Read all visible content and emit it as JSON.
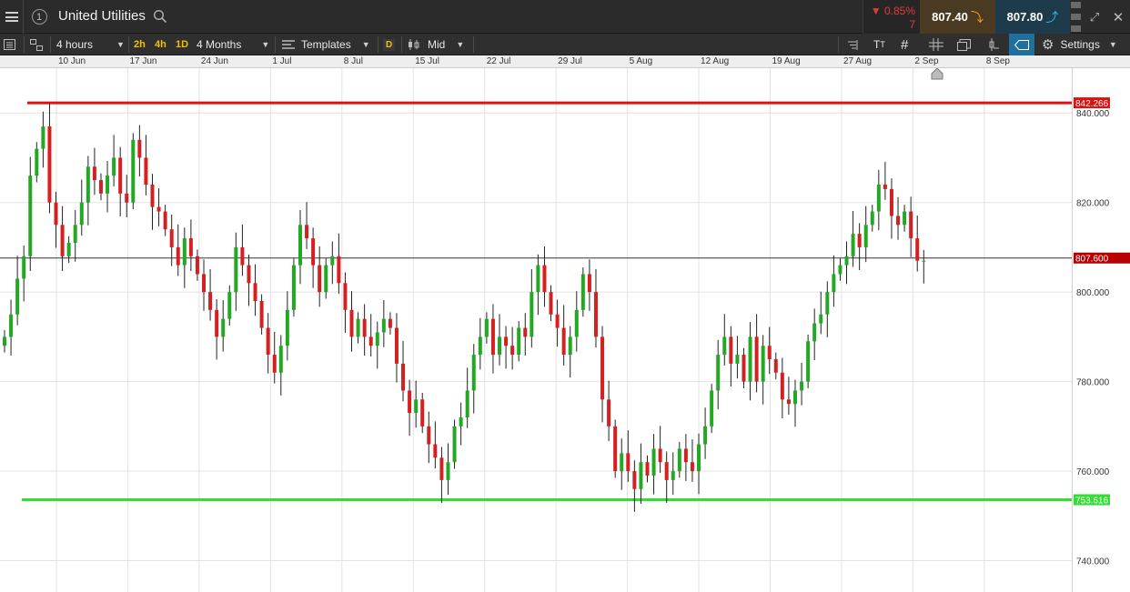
{
  "header": {
    "instrument": "United Utilities",
    "change_pct": "0.85%",
    "change_value": "7",
    "change_icon": "triangle-down-icon",
    "sell_price": "807.40",
    "buy_price": "807.80",
    "colors": {
      "down": "#e23b3b",
      "sell_bg": "#4a3a22",
      "buy_bg": "#1d3b4a"
    }
  },
  "toolbar": {
    "interval": "4 hours",
    "quick_2h": "2h",
    "quick_4h": "4h",
    "quick_1d": "1D",
    "range": "4 Months",
    "templates": "Templates",
    "d_badge": "D",
    "price_type": "Mid",
    "settings": "Settings"
  },
  "chart_data": {
    "type": "candlestick",
    "instrument": "United Utilities",
    "ylim": [
      733,
      850
    ],
    "y_ticks": [
      740,
      760,
      780,
      800,
      820,
      840
    ],
    "y_tick_labels": [
      "740.000",
      "760.000",
      "780.000",
      "800.000",
      "820.000",
      "840.000"
    ],
    "x_tick_labels": [
      "10 Jun",
      "17 Jun",
      "24 Jun",
      "1 Jul",
      "8 Jul",
      "15 Jul",
      "22 Jul",
      "29 Jul",
      "5 Aug",
      "12 Aug",
      "19 Aug",
      "27 Aug",
      "2 Sep",
      "8 Sep"
    ],
    "grid": true,
    "current_price": 807.6,
    "current_price_label": "807.600",
    "resistance": 842.266,
    "resistance_label": "842.266",
    "support": 753.616,
    "support_label": "753.616",
    "colors": {
      "up": "#22a822",
      "down": "#d42020",
      "resistance": "#e01010",
      "support": "#33dd33",
      "current": "#b80000"
    },
    "closes": [
      790,
      795,
      803,
      808,
      826,
      832,
      837,
      820,
      815,
      808,
      811,
      815,
      820,
      828,
      825,
      822,
      826,
      830,
      822,
      820,
      834,
      830,
      824,
      819,
      818,
      814,
      810,
      806,
      812,
      808,
      804,
      800,
      796,
      790,
      794,
      800,
      810,
      806,
      802,
      798,
      792,
      786,
      782,
      788,
      796,
      806,
      815,
      812,
      806,
      800,
      806,
      808,
      802,
      796,
      790,
      794,
      790,
      788,
      791,
      794,
      792,
      784,
      778,
      773,
      776,
      770,
      766,
      763,
      758,
      762,
      770,
      772,
      778,
      786,
      790,
      794,
      786,
      790,
      788,
      786,
      792,
      790,
      800,
      806,
      800,
      795,
      792,
      786,
      790,
      796,
      804,
      800,
      790,
      776,
      770,
      760,
      764,
      760,
      756,
      762,
      759,
      765,
      762,
      758,
      760,
      765,
      762,
      760,
      766,
      770,
      778,
      786,
      790,
      784,
      786,
      780,
      790,
      780,
      788,
      785,
      782,
      776,
      775,
      778,
      780,
      789,
      793,
      795,
      800,
      804,
      806,
      808,
      813,
      810,
      815,
      818,
      824,
      823,
      817,
      815,
      818,
      812,
      807,
      807
    ]
  }
}
